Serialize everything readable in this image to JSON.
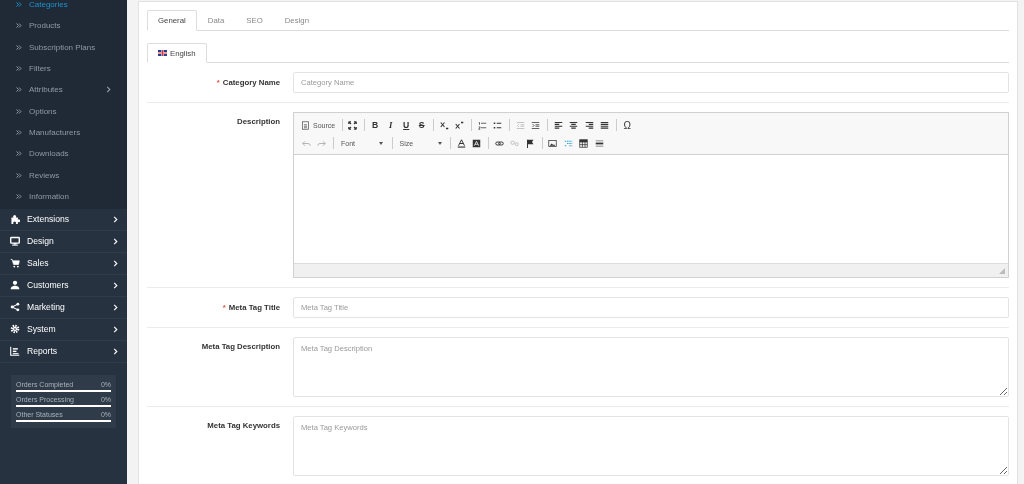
{
  "sidebar": {
    "submenu": [
      {
        "label": "Categories",
        "selected": true,
        "has_children": false
      },
      {
        "label": "Products",
        "selected": false,
        "has_children": false
      },
      {
        "label": "Subscription Plans",
        "selected": false,
        "has_children": false
      },
      {
        "label": "Filters",
        "selected": false,
        "has_children": false
      },
      {
        "label": "Attributes",
        "selected": false,
        "has_children": true
      },
      {
        "label": "Options",
        "selected": false,
        "has_children": false
      },
      {
        "label": "Manufacturers",
        "selected": false,
        "has_children": false
      },
      {
        "label": "Downloads",
        "selected": false,
        "has_children": false
      },
      {
        "label": "Reviews",
        "selected": false,
        "has_children": false
      },
      {
        "label": "Information",
        "selected": false,
        "has_children": false
      }
    ],
    "menu": [
      {
        "label": "Extensions",
        "kind": "puzzle"
      },
      {
        "label": "Design",
        "kind": "monitor"
      },
      {
        "label": "Sales",
        "kind": "cart"
      },
      {
        "label": "Customers",
        "kind": "user"
      },
      {
        "label": "Marketing",
        "kind": "share"
      },
      {
        "label": "System",
        "kind": "gear"
      },
      {
        "label": "Reports",
        "kind": "chart"
      }
    ],
    "stats": [
      {
        "label": "Orders Completed",
        "value": "0%",
        "level": 0
      },
      {
        "label": "Orders Processing",
        "value": "0%",
        "level": 0
      },
      {
        "label": "Other Statuses",
        "value": "0%",
        "level": 0
      }
    ]
  },
  "tabs": [
    {
      "label": "General",
      "selected": true
    },
    {
      "label": "Data",
      "selected": false
    },
    {
      "label": "SEO",
      "selected": false
    },
    {
      "label": "Design",
      "selected": false
    }
  ],
  "language_tabs": [
    {
      "label": "English",
      "selected": true
    }
  ],
  "form": [
    {
      "kind": "input",
      "label": "Category Name",
      "required_mark": "*",
      "placeholder": "Category Name"
    },
    {
      "kind": "editor",
      "label": "Description",
      "toolbar": [
        [
          {
            "kind": "source",
            "label": "Source",
            "disabled": false
          },
          {
            "kind": "sep"
          },
          {
            "kind": "maximize",
            "disabled": false
          },
          {
            "kind": "sep"
          },
          {
            "kind": "bold",
            "label": "B",
            "disabled": false
          },
          {
            "kind": "italic",
            "label": "I",
            "disabled": false
          },
          {
            "kind": "underline",
            "label": "U",
            "disabled": false
          },
          {
            "kind": "strike",
            "label": "S",
            "disabled": false
          },
          {
            "kind": "sep"
          },
          {
            "kind": "subscript",
            "disabled": false
          },
          {
            "kind": "superscript",
            "disabled": false
          },
          {
            "kind": "sep"
          },
          {
            "kind": "numbered",
            "disabled": false
          },
          {
            "kind": "bulleted",
            "disabled": false
          },
          {
            "kind": "sep"
          },
          {
            "kind": "outdent",
            "disabled": true
          },
          {
            "kind": "indent",
            "disabled": false
          },
          {
            "kind": "sep"
          },
          {
            "kind": "alignleft",
            "disabled": false
          },
          {
            "kind": "aligncenter",
            "disabled": false
          },
          {
            "kind": "alignright",
            "disabled": false
          },
          {
            "kind": "justify",
            "disabled": false
          },
          {
            "kind": "sep"
          },
          {
            "kind": "symbol",
            "label": "Ω",
            "disabled": false
          }
        ],
        [
          {
            "kind": "undo",
            "disabled": true
          },
          {
            "kind": "redo",
            "disabled": true
          },
          {
            "kind": "sep"
          },
          {
            "kind": "combo",
            "label": "Font"
          },
          {
            "kind": "sep"
          },
          {
            "kind": "combo",
            "label": "Size"
          },
          {
            "kind": "sep"
          },
          {
            "kind": "textcolor",
            "disabled": false
          },
          {
            "kind": "bgcolor",
            "disabled": false
          },
          {
            "kind": "sep"
          },
          {
            "kind": "link",
            "disabled": false
          },
          {
            "kind": "unlink",
            "disabled": true
          },
          {
            "kind": "flag",
            "disabled": false
          },
          {
            "kind": "sep"
          },
          {
            "kind": "image",
            "disabled": false
          },
          {
            "kind": "special",
            "disabled": false
          },
          {
            "kind": "table",
            "disabled": false
          },
          {
            "kind": "hrule",
            "disabled": false
          }
        ]
      ]
    },
    {
      "kind": "input",
      "label": "Meta Tag Title",
      "required_mark": "*",
      "placeholder": "Meta Tag Title"
    },
    {
      "kind": "textarea",
      "label": "Meta Tag Description",
      "placeholder": "Meta Tag Description"
    },
    {
      "kind": "textarea",
      "label": "Meta Tag Keywords",
      "placeholder": "Meta Tag Keywords"
    }
  ]
}
